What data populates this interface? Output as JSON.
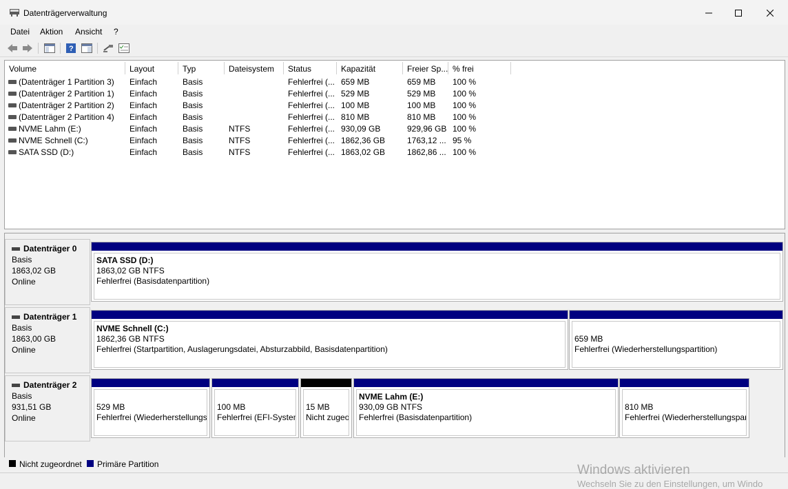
{
  "window": {
    "title": "Datenträgerverwaltung"
  },
  "menu": [
    "Datei",
    "Aktion",
    "Ansicht",
    "?"
  ],
  "toolbar": {
    "icons": [
      "back-arrow-icon",
      "forward-arrow-icon",
      "console-tree-icon",
      "help-icon",
      "properties-icon",
      "connect-icon",
      "checklist-icon"
    ]
  },
  "columns": [
    "Volume",
    "Layout",
    "Typ",
    "Dateisystem",
    "Status",
    "Kapazität",
    "Freier Sp...",
    "% frei"
  ],
  "volumes": [
    {
      "volume": "(Datenträger 1 Partition 3)",
      "layout": "Einfach",
      "typ": "Basis",
      "fs": "",
      "status": "Fehlerfrei (...",
      "cap": "659 MB",
      "free": "659 MB",
      "pct": "100 %"
    },
    {
      "volume": "(Datenträger 2 Partition 1)",
      "layout": "Einfach",
      "typ": "Basis",
      "fs": "",
      "status": "Fehlerfrei (...",
      "cap": "529 MB",
      "free": "529 MB",
      "pct": "100 %"
    },
    {
      "volume": "(Datenträger 2 Partition 2)",
      "layout": "Einfach",
      "typ": "Basis",
      "fs": "",
      "status": "Fehlerfrei (...",
      "cap": "100 MB",
      "free": "100 MB",
      "pct": "100 %"
    },
    {
      "volume": "(Datenträger 2 Partition 4)",
      "layout": "Einfach",
      "typ": "Basis",
      "fs": "",
      "status": "Fehlerfrei (...",
      "cap": "810 MB",
      "free": "810 MB",
      "pct": "100 %"
    },
    {
      "volume": "NVME Lahm (E:)",
      "layout": "Einfach",
      "typ": "Basis",
      "fs": "NTFS",
      "status": "Fehlerfrei (...",
      "cap": "930,09 GB",
      "free": "929,96 GB",
      "pct": "100 %"
    },
    {
      "volume": "NVME Schnell (C:)",
      "layout": "Einfach",
      "typ": "Basis",
      "fs": "NTFS",
      "status": "Fehlerfrei (...",
      "cap": "1862,36 GB",
      "free": "1763,12 ...",
      "pct": "95 %"
    },
    {
      "volume": "SATA SSD (D:)",
      "layout": "Einfach",
      "typ": "Basis",
      "fs": "NTFS",
      "status": "Fehlerfrei (...",
      "cap": "1863,02 GB",
      "free": "1862,86 ...",
      "pct": "100 %"
    }
  ],
  "disks": [
    {
      "name": "Datenträger 0",
      "type": "Basis",
      "size": "1863,02 GB",
      "state": "Online",
      "partitions": [
        {
          "title": "SATA SSD  (D:)",
          "size": "1863,02 GB NTFS",
          "status": "Fehlerfrei (Basisdatenpartition)"
        }
      ]
    },
    {
      "name": "Datenträger 1",
      "type": "Basis",
      "size": "1863,00 GB",
      "state": "Online",
      "partitions": [
        {
          "title": "NVME Schnell  (C:)",
          "size": "1862,36 GB NTFS",
          "status": "Fehlerfrei (Startpartition, Auslagerungsdatei, Absturzabbild, Basisdatenpartition)"
        },
        {
          "title": "",
          "size": "659 MB",
          "status": "Fehlerfrei (Wiederherstellungspartition)"
        }
      ]
    },
    {
      "name": "Datenträger 2",
      "type": "Basis",
      "size": "931,51 GB",
      "state": "Online",
      "partitions": [
        {
          "title": "",
          "size": "529 MB",
          "status": "Fehlerfrei (Wiederherstellungsp"
        },
        {
          "title": "",
          "size": "100 MB",
          "status": "Fehlerfrei (EFI-System"
        },
        {
          "title": "",
          "size": "15 MB",
          "status": "Nicht zugeo"
        },
        {
          "title": "NVME Lahm  (E:)",
          "size": "930,09 GB NTFS",
          "status": "Fehlerfrei (Basisdatenpartition)"
        },
        {
          "title": "",
          "size": "810 MB",
          "status": "Fehlerfrei (Wiederherstellungspar"
        }
      ]
    }
  ],
  "legend": {
    "unallocated": "Nicht zugeordnet",
    "primary": "Primäre Partition",
    "colors": {
      "unallocated": "#000000",
      "primary": "#000080"
    }
  },
  "watermark": {
    "line1": "Windows aktivieren",
    "line2": "Wechseln Sie zu den Einstellungen, um Windo"
  }
}
